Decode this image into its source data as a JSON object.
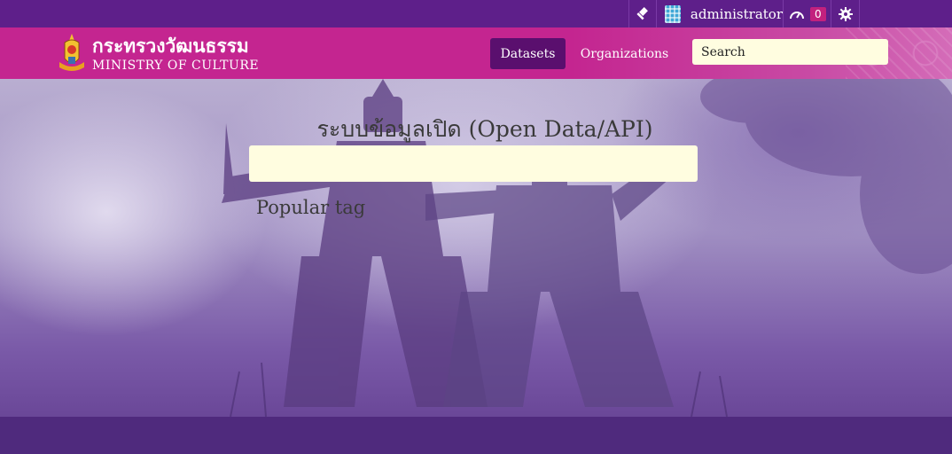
{
  "account": {
    "username": "administrator",
    "dashboard_count": "0",
    "icons": {
      "sysadmin": "gavel-icon",
      "avatar": "user-avatar",
      "dashboard": "dashboard-icon",
      "settings": "gear-icon"
    }
  },
  "brand": {
    "name_thai": "กระทรวงวัฒนธรรม",
    "name_en": "MINISTRY OF CULTURE"
  },
  "nav": {
    "items": [
      {
        "label": "Datasets",
        "active": true
      },
      {
        "label": "Organizations",
        "active": false
      }
    ],
    "search_placeholder": "Search"
  },
  "hero": {
    "title": "ระบบข้อมูลเปิด (Open Data/API)",
    "search_value": "",
    "popular_tags_heading": "Popular tag"
  },
  "colors": {
    "account_bar": "#5e1f8a",
    "masthead": "#c42590",
    "active_nav": "#5a0f6e",
    "input_bg": "#fffde0",
    "badge": "#c2217e"
  }
}
